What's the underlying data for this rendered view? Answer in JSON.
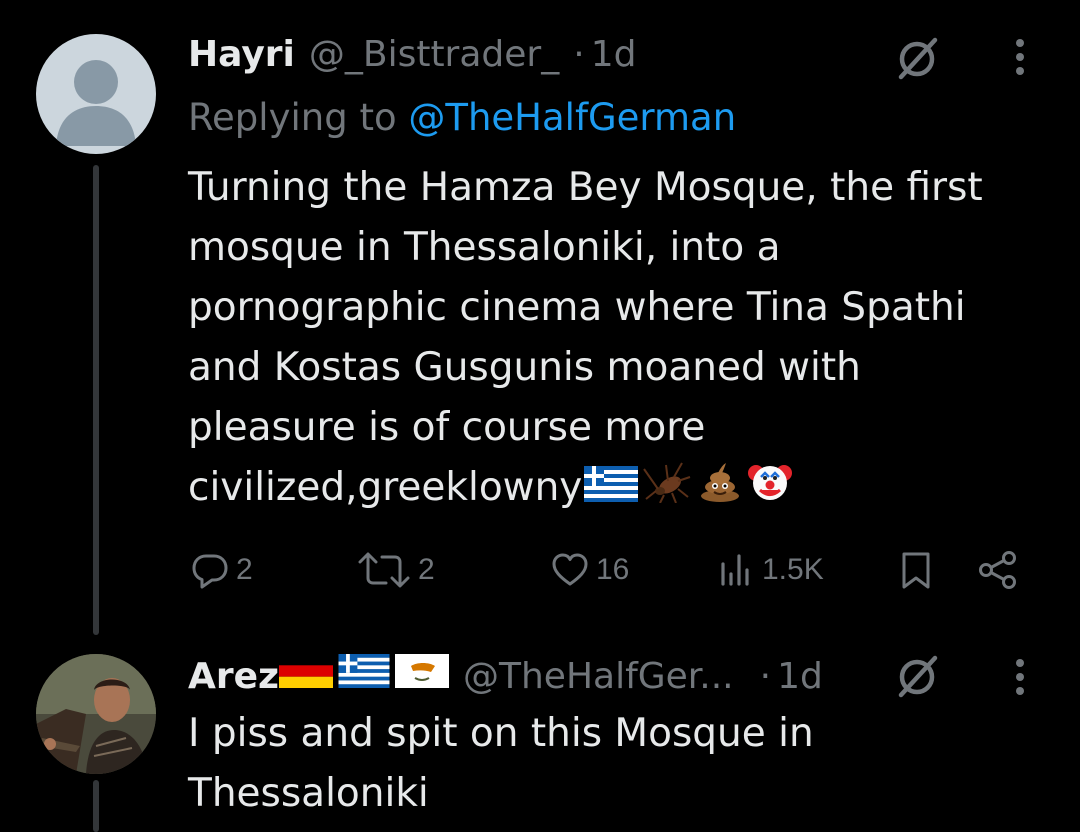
{
  "colors": {
    "background": "#000000",
    "text": "#e7e9ea",
    "muted": "#71767b",
    "link": "#1d9bf0",
    "thread_line": "#333639"
  },
  "tweet1": {
    "name": "Hayri",
    "handle": "@_Bisttrader_",
    "separator": "·",
    "time": "1d",
    "replying_prefix": "Replying to ",
    "replying_handle": "@TheHalfGerman",
    "text_lines": [
      "Turning the Hamza Bey Mosque, the first",
      "mosque in Thessaloniki, into a",
      "pornographic cinema where Tina Spathi",
      "and Kostas Gusgunis moaned with",
      "pleasure is of course more",
      "civilized,greeklowny"
    ],
    "trailing_emojis": [
      "greece-flag",
      "cockroach",
      "pile-of-poo",
      "clown-face"
    ],
    "actions": {
      "replies": "2",
      "reposts": "2",
      "likes": "16",
      "views": "1.5K"
    },
    "icons": [
      "grok-icon",
      "more-icon",
      "reply-icon",
      "repost-icon",
      "like-icon",
      "views-icon",
      "bookmark-icon",
      "share-icon"
    ]
  },
  "tweet2": {
    "name": "Arez",
    "name_flags": [
      "germany-flag",
      "greece-flag",
      "cyprus-flag"
    ],
    "handle": "@TheHalfGer...",
    "separator": "·",
    "time": "1d",
    "text_lines": [
      "I piss and spit on this Mosque in",
      "Thessaloniki"
    ]
  }
}
